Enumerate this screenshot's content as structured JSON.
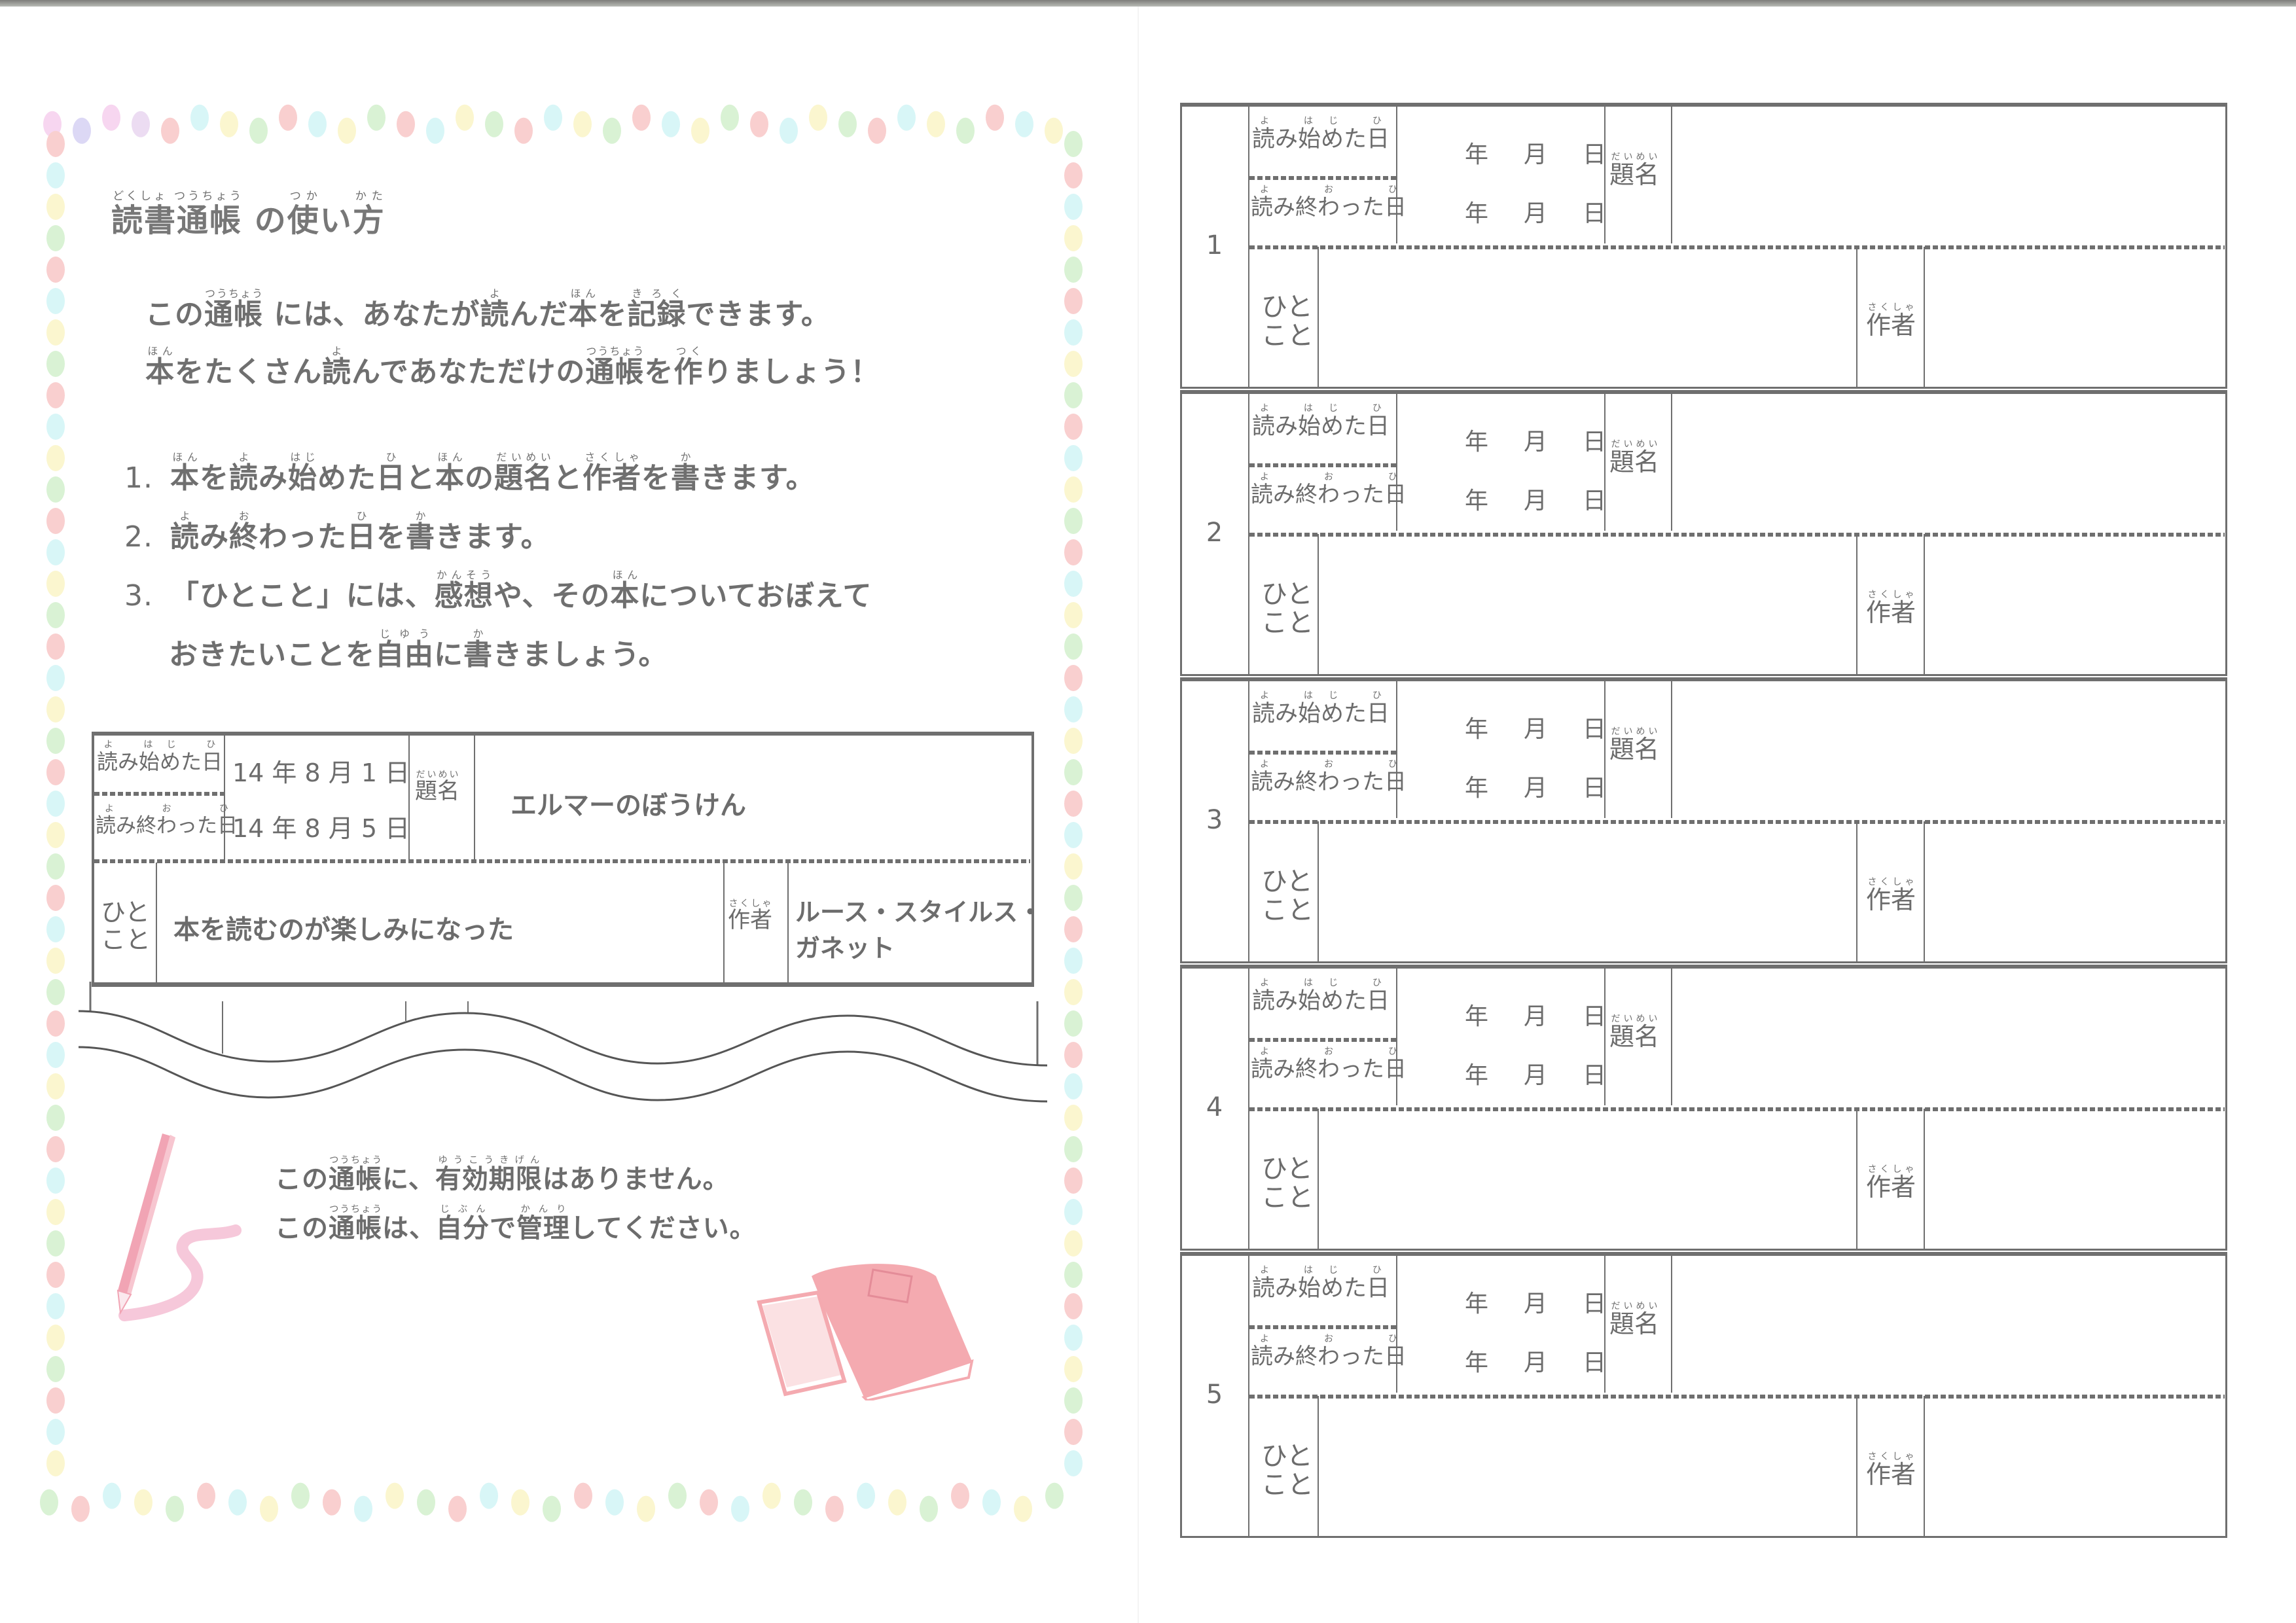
{
  "left_page": {
    "title": {
      "parts": [
        {
          "text": "読書通帳",
          "ruby": "どくしょ つうちょう"
        },
        {
          "text": " の",
          "ruby": ""
        },
        {
          "text": "使",
          "ruby": "つか"
        },
        {
          "text": "い",
          "ruby": ""
        },
        {
          "text": "方",
          "ruby": "かた"
        }
      ]
    },
    "intro": [
      [
        {
          "text": "この",
          "ruby": ""
        },
        {
          "text": "通帳",
          "ruby": "つうちょう"
        },
        {
          "text": " には、あなたが",
          "ruby": ""
        },
        {
          "text": "読",
          "ruby": "よ"
        },
        {
          "text": "んだ",
          "ruby": ""
        },
        {
          "text": "本",
          "ruby": "ほん"
        },
        {
          "text": "を",
          "ruby": ""
        },
        {
          "text": "記録",
          "ruby": "きろく"
        },
        {
          "text": "できます。",
          "ruby": ""
        }
      ],
      [
        {
          "text": "本",
          "ruby": "ほん"
        },
        {
          "text": "をたくさん",
          "ruby": ""
        },
        {
          "text": "読",
          "ruby": "よ"
        },
        {
          "text": "んであなただけの",
          "ruby": ""
        },
        {
          "text": "通帳",
          "ruby": "つうちょう"
        },
        {
          "text": "を",
          "ruby": ""
        },
        {
          "text": "作",
          "ruby": "つく"
        },
        {
          "text": "りましょう！",
          "ruby": ""
        }
      ]
    ],
    "steps": [
      {
        "number": "1.",
        "parts": [
          {
            "text": "本",
            "ruby": "ほん"
          },
          {
            "text": "を",
            "ruby": ""
          },
          {
            "text": "読",
            "ruby": "よ"
          },
          {
            "text": "み",
            "ruby": ""
          },
          {
            "text": "始",
            "ruby": "はじ"
          },
          {
            "text": "めた",
            "ruby": ""
          },
          {
            "text": "日",
            "ruby": "ひ"
          },
          {
            "text": "と",
            "ruby": ""
          },
          {
            "text": "本",
            "ruby": "ほん"
          },
          {
            "text": "の",
            "ruby": ""
          },
          {
            "text": "題名",
            "ruby": "だいめい"
          },
          {
            "text": "と",
            "ruby": ""
          },
          {
            "text": "作者",
            "ruby": "さくしゃ"
          },
          {
            "text": "を",
            "ruby": ""
          },
          {
            "text": "書",
            "ruby": "か"
          },
          {
            "text": "きます。",
            "ruby": ""
          }
        ]
      },
      {
        "number": "2.",
        "parts": [
          {
            "text": "読",
            "ruby": "よ"
          },
          {
            "text": "み",
            "ruby": ""
          },
          {
            "text": "終",
            "ruby": "お"
          },
          {
            "text": "わった",
            "ruby": ""
          },
          {
            "text": "日",
            "ruby": "ひ"
          },
          {
            "text": "を",
            "ruby": ""
          },
          {
            "text": "書",
            "ruby": "か"
          },
          {
            "text": "きます。",
            "ruby": ""
          }
        ]
      },
      {
        "number": "3.",
        "parts": [
          {
            "text": "「ひとこと」には、",
            "ruby": ""
          },
          {
            "text": "感想",
            "ruby": "かんそう"
          },
          {
            "text": "や、その",
            "ruby": ""
          },
          {
            "text": "本",
            "ruby": "ほん"
          },
          {
            "text": "についておぼえて",
            "ruby": ""
          }
        ]
      },
      {
        "number": "",
        "parts": [
          {
            "text": "おきたいことを",
            "ruby": ""
          },
          {
            "text": "自由",
            "ruby": "じゆう"
          },
          {
            "text": "に",
            "ruby": ""
          },
          {
            "text": "書",
            "ruby": "か"
          },
          {
            "text": "きましょう。",
            "ruby": ""
          }
        ]
      }
    ],
    "example": {
      "start_label": "読み始めた日",
      "start_label_ruby": "よ はじ ひ",
      "end_label": "読み終わった日",
      "end_label_ruby": "よ お ひ",
      "start_date": "14 年 8 月 1 日",
      "end_date": "14 年 8 月 5 日",
      "title_label": "題名",
      "title_label_ruby": "だいめい",
      "title_value": "エルマーのぼうけん",
      "comment_label_line1": "ひと",
      "comment_label_line2": "こと",
      "comment_value": "本を読むのが楽しみになった",
      "author_label": "作者",
      "author_label_ruby": "さくしゃ",
      "author_value_line1": "ルース・スタイルス・",
      "author_value_line2": "ガネット"
    },
    "notices": [
      [
        {
          "text": "この",
          "ruby": ""
        },
        {
          "text": "通帳",
          "ruby": "つうちょう"
        },
        {
          "text": "に、",
          "ruby": ""
        },
        {
          "text": "有効期限",
          "ruby": "ゆうこうきげん"
        },
        {
          "text": "はありません。",
          "ruby": ""
        }
      ],
      [
        {
          "text": "この",
          "ruby": ""
        },
        {
          "text": "通帳",
          "ruby": "つうちょう"
        },
        {
          "text": "は、",
          "ruby": ""
        },
        {
          "text": "自分",
          "ruby": "じぶん"
        },
        {
          "text": "で",
          "ruby": ""
        },
        {
          "text": "管理",
          "ruby": "かんり"
        },
        {
          "text": "してください。",
          "ruby": ""
        }
      ]
    ],
    "decor": {
      "dot_colors": [
        "#f7d6f0",
        "#d9f2d4",
        "#f9cfcf",
        "#fbf6cf",
        "#d8f6f7",
        "#dcd8f5",
        "#ecdcf2"
      ],
      "pencil_color": "#f1a4b4",
      "book_color": "#f4aab0"
    }
  },
  "right_page": {
    "labels": {
      "start": "読み始めた日",
      "start_ruby": "よ はじ ひ",
      "end": "読み終わった日",
      "end_ruby": "よ お ひ",
      "year": "年",
      "month": "月",
      "day": "日",
      "title": "題名",
      "title_ruby": "だいめい",
      "comment_line1": "ひと",
      "comment_line2": "こと",
      "author": "作者",
      "author_ruby": "さくしゃ"
    },
    "records": [
      {
        "number": "1",
        "start_date": "",
        "end_date": "",
        "title": "",
        "comment": "",
        "author": ""
      },
      {
        "number": "2",
        "start_date": "",
        "end_date": "",
        "title": "",
        "comment": "",
        "author": ""
      },
      {
        "number": "3",
        "start_date": "",
        "end_date": "",
        "title": "",
        "comment": "",
        "author": ""
      },
      {
        "number": "4",
        "start_date": "",
        "end_date": "",
        "title": "",
        "comment": "",
        "author": ""
      },
      {
        "number": "5",
        "start_date": "",
        "end_date": "",
        "title": "",
        "comment": "",
        "author": ""
      }
    ]
  }
}
